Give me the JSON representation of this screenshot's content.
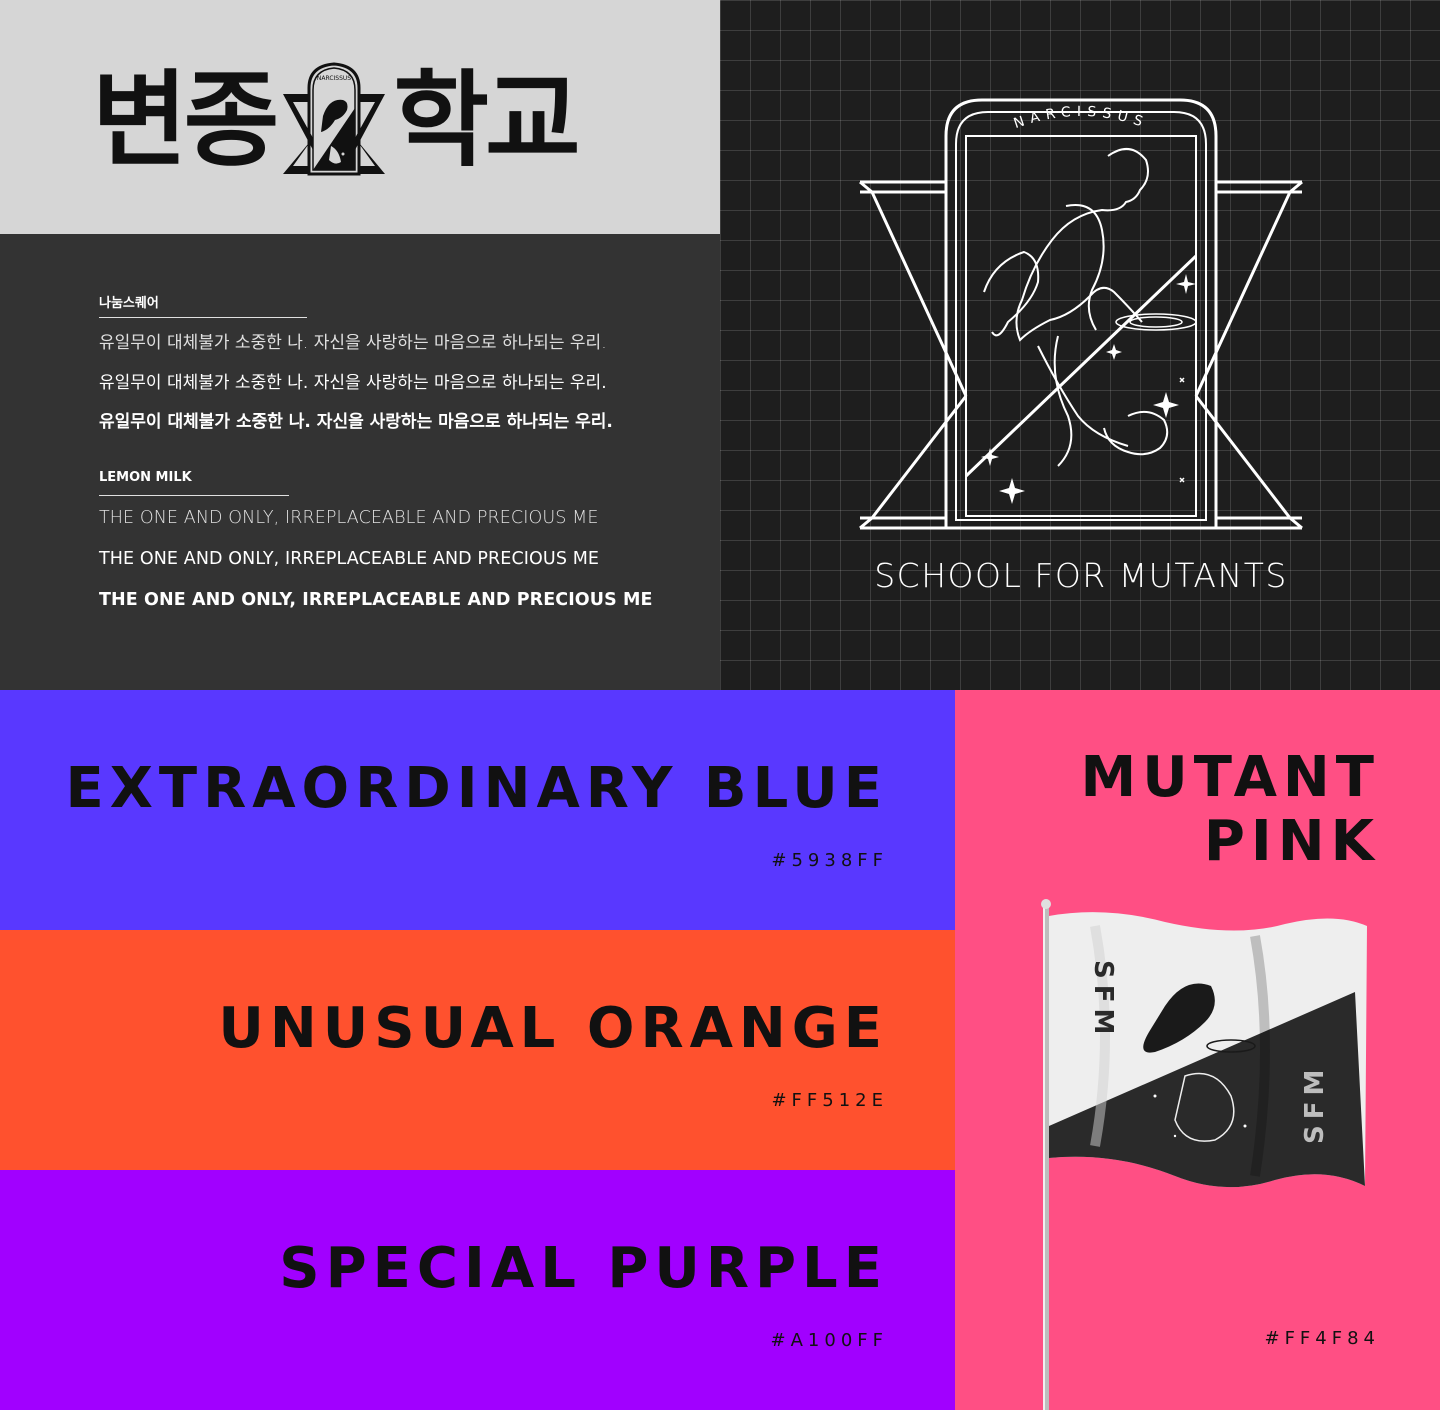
{
  "wordmark": {
    "chars_left": "변종",
    "chars_right": "학교",
    "emblem_arc_text": "NARCISSUS"
  },
  "typography": {
    "korean_font_label": "나눔스퀘어",
    "korean_samples": [
      "유일무이 대체불가 소중한 나. 자신을 사랑하는 마음으로 하나되는 우리.",
      "유일무이 대체불가 소중한 나. 자신을 사랑하는 마음으로 하나되는 우리.",
      "유일무이 대체불가 소중한 나. 자신을 사랑하는 마음으로 하나되는 우리."
    ],
    "english_font_label": "LEMON MILK",
    "english_samples": [
      "THE ONE AND ONLY, IRREPLACEABLE AND PRECIOUS ME",
      "THE ONE AND ONLY, IRREPLACEABLE AND PRECIOUS ME",
      "THE ONE AND ONLY, IRREPLACEABLE AND PRECIOUS ME"
    ]
  },
  "emblem": {
    "arc_text": "NARCISSUS",
    "caption": "SCHOOL FOR MUTANTS"
  },
  "colors": {
    "blue": {
      "name": "EXTRAORDINARY BLUE",
      "hex": "#5938FF"
    },
    "orange": {
      "name": "UNUSUAL ORANGE",
      "hex": "#FF512E"
    },
    "purple": {
      "name": "SPECIAL PURPLE",
      "hex": "#A100FF"
    },
    "pink": {
      "name_line1": "MUTANT",
      "name_line2": "PINK",
      "hex": "#FF4F84"
    }
  },
  "flag": {
    "text_top": "SFM",
    "text_bottom": "SFM"
  }
}
